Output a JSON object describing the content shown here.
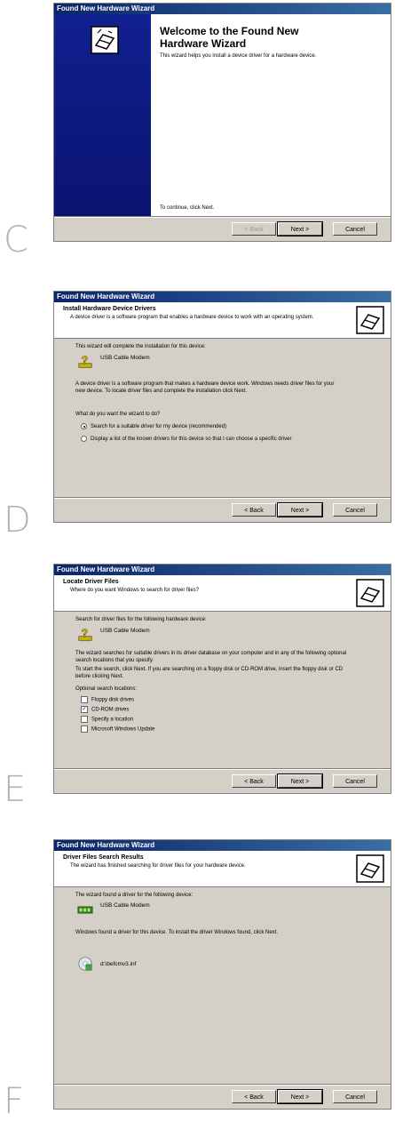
{
  "letters": [
    "C",
    "D",
    "E",
    "F"
  ],
  "title_bar": "Found New Hardware Wizard",
  "buttons": {
    "back": "< Back",
    "next": "Next >",
    "cancel": "Cancel"
  },
  "panel_c": {
    "title": "Welcome to the Found New Hardware Wizard",
    "description": "This wizard helps you install a device driver for a hardware device.",
    "continue": "To continue, click Next."
  },
  "panel_d": {
    "heading": "Install Hardware Device Drivers",
    "subheading": "A device driver is a software program that enables a hardware device to work with an operating system.",
    "complete_text": "This wizard will complete the installation for this device:",
    "device": "USB Cable Modem",
    "explain": "A device driver is a software program that makes a hardware device work. Windows needs driver files for your new device. To locate driver files and complete the installation click Next.",
    "question": "What do you want the wizard to do?",
    "options": [
      "Search for a suitable driver for my device (recommended)",
      "Display a list of the known drivers for this device so that I can choose a specific driver"
    ]
  },
  "panel_e": {
    "heading": "Locate Driver Files",
    "subheading": "Where do you want Windows to search for driver files?",
    "search_text": "Search for driver files for the following hardware device:",
    "device": "USB Cable Modem",
    "para1": "The wizard searches for suitable drivers in its driver database on your computer and in any of the following optional search locations that you specify.",
    "para2": "To start the search, click Next. If you are searching on a floppy disk or CD-ROM drive, insert the floppy disk or CD before clicking Next.",
    "optional_label": "Optional search locations:",
    "locations": [
      {
        "label": "Floppy disk drives",
        "checked": false
      },
      {
        "label": "CD-ROM drives",
        "checked": true
      },
      {
        "label": "Specify a location",
        "checked": false
      },
      {
        "label": "Microsoft Windows Update",
        "checked": false
      }
    ]
  },
  "panel_f": {
    "heading": "Driver Files Search Results",
    "subheading": "The wizard has finished searching for driver files for your hardware device.",
    "found_text": "The wizard found a driver for the following device:",
    "device": "USB Cable Modem",
    "install_text": "Windows found a driver for this device. To install the driver Windows found, click Next.",
    "file": "d:\\befcmv3.inf"
  }
}
